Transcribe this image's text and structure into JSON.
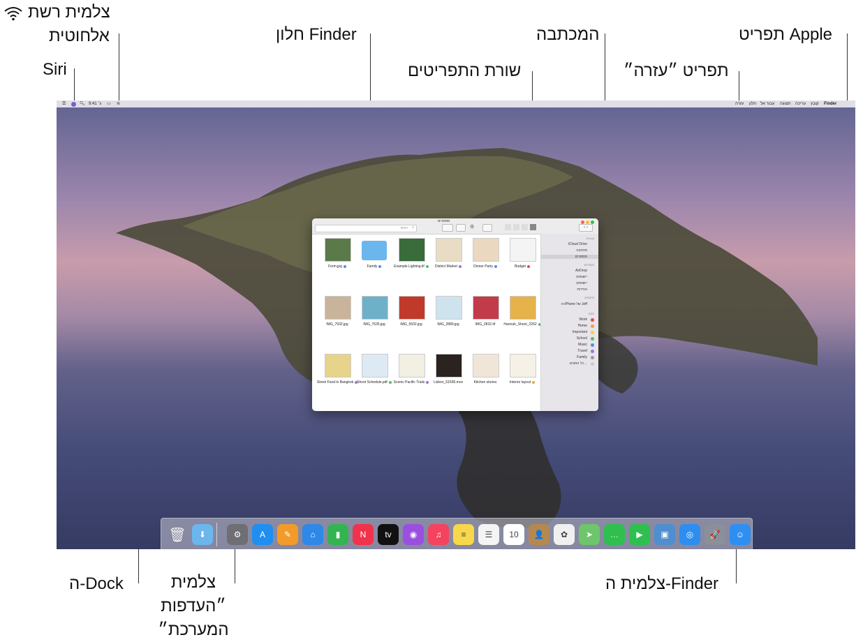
{
  "callouts": {
    "network_status": "צלמית רשת",
    "wireless": "אלחוטית",
    "siri": "Siri",
    "finder_window": "חלון Finder",
    "desktop": "המכתבה",
    "apple_menu": "תפריט Apple",
    "menu_bar": "שורת התפריטים",
    "help_menu": "תפריט ״עזרה״",
    "dock": "ה-Dock",
    "system_prefs": [
      "צלמית",
      "״העדפות",
      "המערכת״"
    ],
    "finder_icon": "צלמית ה-Finder"
  },
  "menubar": {
    "apple_glyph": "",
    "app_name": "Finder",
    "items": [
      "קובץ",
      "עריכה",
      "תצוגה",
      "עבור אל",
      "חלון",
      "עזרה"
    ],
    "time": "9:41 ג׳"
  },
  "finder": {
    "title": "מסמכים",
    "search_placeholder": "חפש",
    "sidebar": {
      "icloud_header": "iCloud",
      "icloud_items": [
        "iCloud Drive",
        "מכתבה",
        "מסמכים"
      ],
      "fav_header": "מועדפים",
      "fav_items": [
        "AirDrop",
        "יישומים",
        "יישומים",
        "הורדות"
      ],
      "locations_header": "מיקומים",
      "locations_items": [
        "ה-iPhone של Jeff"
      ],
      "tags_header": "תגים",
      "tags": [
        {
          "name": "Work",
          "color": "#e5484d"
        },
        {
          "name": "Home",
          "color": "#f1a33c"
        },
        {
          "name": "Important",
          "color": "#f2d13c"
        },
        {
          "name": "School",
          "color": "#51c15a"
        },
        {
          "name": "Music",
          "color": "#4b8ef0"
        },
        {
          "name": "Travel",
          "color": "#a570d8"
        },
        {
          "name": "Family",
          "color": "#9a9a9a"
        },
        {
          "name": "כל התגים…",
          "color": "#c9c9c9"
        }
      ]
    },
    "files": [
      {
        "name": "Form.jpg",
        "tag": "#4b8ef0"
      },
      {
        "name": "Family",
        "tag": "#4b8ef0"
      },
      {
        "name": "Example Lighting.tif",
        "tag": "#51c15a"
      },
      {
        "name": "District Market",
        "tag": "#a570d8"
      },
      {
        "name": "Dinner Party",
        "tag": "#4b8ef0"
      },
      {
        "name": "Budget",
        "tag": "#e5484d"
      },
      {
        "name": "IMG_7932.jpg",
        "tag": ""
      },
      {
        "name": "IMG_7635.jpg",
        "tag": ""
      },
      {
        "name": "IMG_5502.jpg",
        "tag": ""
      },
      {
        "name": "IMG_2889.jpg",
        "tag": ""
      },
      {
        "name": "IMG_2832.tif",
        "tag": ""
      },
      {
        "name": "Hannah_Shoot_2262",
        "tag": "#51c15a"
      },
      {
        "name": "Street Food in Bangkok",
        "tag": "#a570d8"
      },
      {
        "name": "Shoot Schedule.pdf",
        "tag": "#51c15a"
      },
      {
        "name": "Scenic Pacific Trails",
        "tag": "#a570d8"
      },
      {
        "name": "Lisbon_61695.mov",
        "tag": ""
      },
      {
        "name": "Kitchen stories",
        "tag": ""
      },
      {
        "name": "Interior layout",
        "tag": "#f1a33c"
      }
    ]
  },
  "dock": {
    "icons": [
      {
        "name": "trash-icon",
        "glyph": "🗑",
        "color": "#d8d8d8"
      },
      {
        "name": "downloads-folder-icon",
        "glyph": "⬇",
        "color": "#6cb6ee"
      },
      {
        "name": "system-preferences-icon",
        "glyph": "⚙",
        "color": "#6e6e73"
      },
      {
        "name": "app-store-icon",
        "glyph": "A",
        "color": "#1f8ef1"
      },
      {
        "name": "pages-icon",
        "glyph": "✎",
        "color": "#f39b2a"
      },
      {
        "name": "keynote-icon",
        "glyph": "⌂",
        "color": "#2e88e8"
      },
      {
        "name": "numbers-icon",
        "glyph": "▮",
        "color": "#34b450"
      },
      {
        "name": "news-icon",
        "glyph": "N",
        "color": "#f0334b"
      },
      {
        "name": "apple-tv-icon",
        "glyph": "tv",
        "color": "#111111"
      },
      {
        "name": "podcasts-icon",
        "glyph": "◉",
        "color": "#9b4fe0"
      },
      {
        "name": "music-icon",
        "glyph": "♫",
        "color": "#f5435f"
      },
      {
        "name": "notes-icon",
        "glyph": "≡",
        "color": "#f8d84a"
      },
      {
        "name": "reminders-icon",
        "glyph": "☰",
        "color": "#f4f4f4"
      },
      {
        "name": "calendar-icon",
        "glyph": "10",
        "color": "#ffffff"
      },
      {
        "name": "contacts-icon",
        "glyph": "👤",
        "color": "#b58850"
      },
      {
        "name": "photos-icon",
        "glyph": "✿",
        "color": "#f0f0f0"
      },
      {
        "name": "maps-icon",
        "glyph": "➤",
        "color": "#6fc56b"
      },
      {
        "name": "messages-icon",
        "glyph": "…",
        "color": "#2fbf4f"
      },
      {
        "name": "facetime-icon",
        "glyph": "▶",
        "color": "#2fbf4f"
      },
      {
        "name": "preview-icon",
        "glyph": "▣",
        "color": "#4f8ecf"
      },
      {
        "name": "safari-icon",
        "glyph": "◎",
        "color": "#2d8ef0"
      },
      {
        "name": "launchpad-icon",
        "glyph": "🚀",
        "color": "#8b8f99"
      },
      {
        "name": "finder-icon",
        "glyph": "☺",
        "color": "#2f8ff1"
      }
    ]
  }
}
